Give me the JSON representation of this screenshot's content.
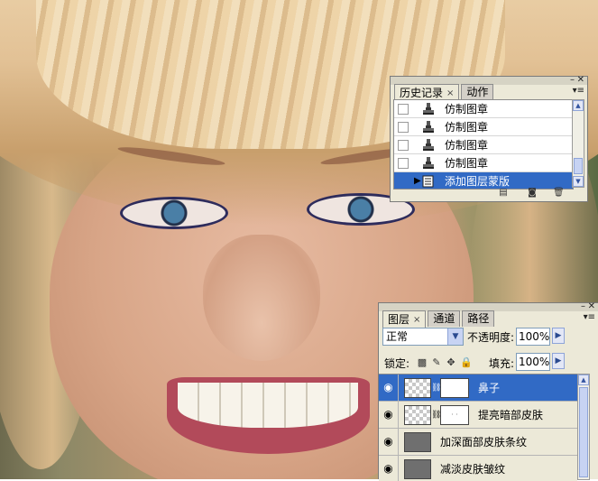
{
  "colors": {
    "selection": "#316ac5",
    "panel_bg": "#ece9d8",
    "scroll_accent": "#8ea4d8"
  },
  "history_panel": {
    "tabs": [
      {
        "label": "历史记录",
        "active": true,
        "closable": true
      },
      {
        "label": "动作",
        "active": false
      }
    ],
    "items": [
      {
        "label": "仿制图章",
        "icon": "clone-stamp-icon",
        "selected": false
      },
      {
        "label": "仿制图章",
        "icon": "clone-stamp-icon",
        "selected": false
      },
      {
        "label": "仿制图章",
        "icon": "clone-stamp-icon",
        "selected": false
      },
      {
        "label": "仿制图章",
        "icon": "clone-stamp-icon",
        "selected": false
      },
      {
        "label": "添加图层蒙版",
        "icon": "history-state-icon",
        "selected": true
      }
    ],
    "bottom_icons": [
      "new-document-from-state-icon",
      "snapshot-camera-icon",
      "trash-icon"
    ]
  },
  "layers_panel": {
    "tabs": [
      {
        "label": "图层",
        "active": true,
        "closable": true
      },
      {
        "label": "通道",
        "active": false
      },
      {
        "label": "路径",
        "active": false
      }
    ],
    "blend_mode": "正常",
    "opacity_label": "不透明度:",
    "opacity_value": "100%",
    "lock_label": "锁定:",
    "fill_label": "填充:",
    "fill_value": "100%",
    "lock_icons": [
      "lock-transparency-icon",
      "lock-brush-icon",
      "lock-move-icon",
      "lock-all-icon"
    ],
    "layers": [
      {
        "name": "鼻子",
        "selected": true,
        "has_mask": true
      },
      {
        "name": "提亮暗部皮肤",
        "selected": false,
        "has_mask": true
      },
      {
        "name": "加深面部皮肤条纹",
        "selected": false,
        "has_mask": false
      },
      {
        "name": "减淡皮肤皱纹",
        "selected": false,
        "has_mask": false
      }
    ]
  }
}
